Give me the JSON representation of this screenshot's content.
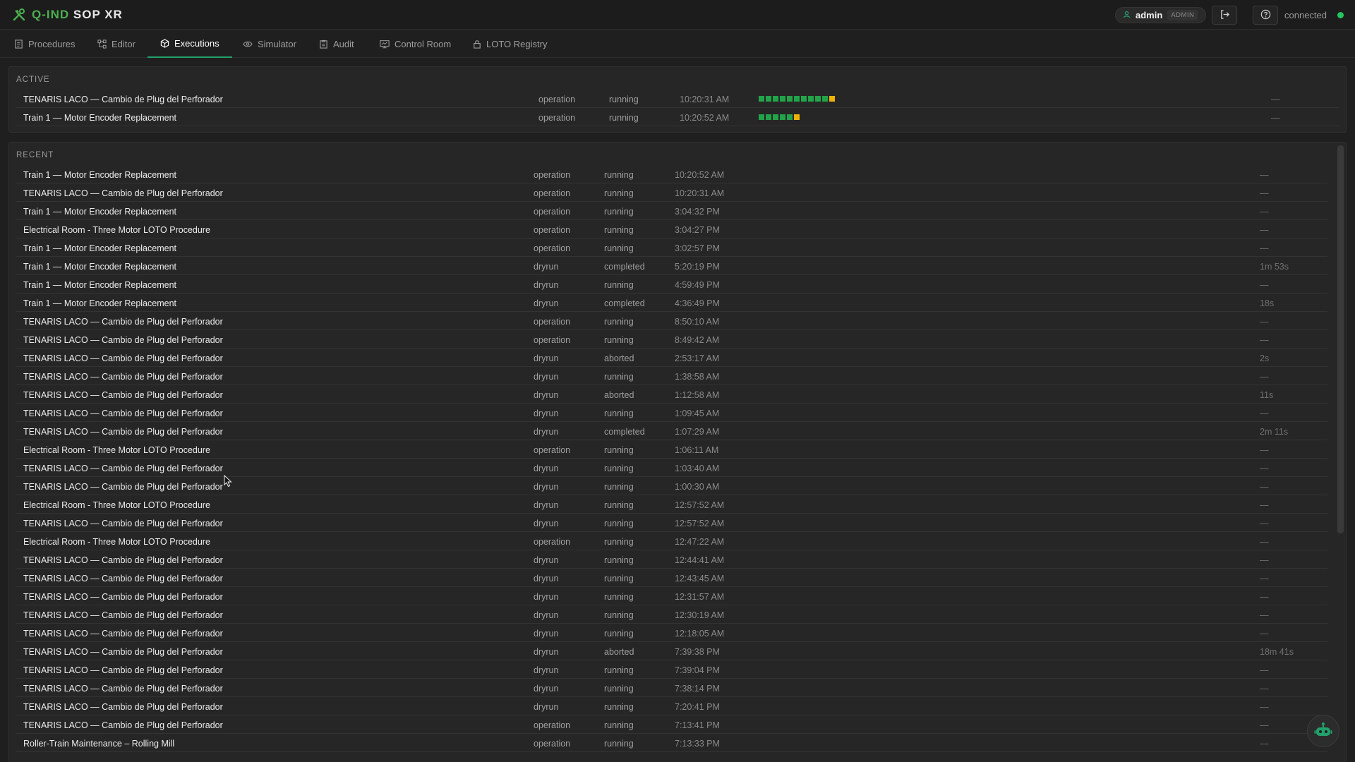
{
  "brand": {
    "part1": "Q-IND",
    "part2": "SOP XR"
  },
  "user": {
    "name": "admin",
    "role": "ADMIN"
  },
  "connection": {
    "label": "connected",
    "color": "#22c55e"
  },
  "icons": {
    "brand": "wrench-hammer-icon",
    "user": "user-icon",
    "logout": "logout-icon",
    "help": "help-icon",
    "assistant": "robot-icon"
  },
  "colors": {
    "accent": "#22a06b",
    "progress_done": "#22a34a",
    "progress_current": "#eab308"
  },
  "tabs": [
    {
      "label": "Procedures",
      "icon": "document-icon"
    },
    {
      "label": "Editor",
      "icon": "flow-icon"
    },
    {
      "label": "Executions",
      "icon": "cube-icon",
      "active": true
    },
    {
      "label": "Simulator",
      "icon": "eye-icon"
    },
    {
      "label": "Audit",
      "icon": "clipboard-icon"
    },
    {
      "label": "Control Room",
      "icon": "monitor-icon"
    },
    {
      "label": "LOTO Registry",
      "icon": "lock-icon"
    }
  ],
  "active": {
    "title": "ACTIVE",
    "rows": [
      {
        "name": "TENARIS LACO — Cambio de Plug del Perforador",
        "mode": "operation",
        "status": "running",
        "time": "10:20:31 AM",
        "progress": {
          "done": 10,
          "current": 1
        },
        "duration": "—"
      },
      {
        "name": "Train 1 — Motor Encoder Replacement",
        "mode": "operation",
        "status": "running",
        "time": "10:20:52 AM",
        "progress": {
          "done": 5,
          "current": 1
        },
        "duration": "—"
      }
    ]
  },
  "recent": {
    "title": "RECENT",
    "rows": [
      {
        "name": "Train 1 — Motor Encoder Replacement",
        "mode": "operation",
        "status": "running",
        "time": "10:20:52 AM",
        "duration": "—"
      },
      {
        "name": "TENARIS LACO — Cambio de Plug del Perforador",
        "mode": "operation",
        "status": "running",
        "time": "10:20:31 AM",
        "duration": "—"
      },
      {
        "name": "Train 1 — Motor Encoder Replacement",
        "mode": "operation",
        "status": "running",
        "time": "3:04:32 PM",
        "duration": "—"
      },
      {
        "name": "Electrical Room - Three Motor LOTO Procedure",
        "mode": "operation",
        "status": "running",
        "time": "3:04:27 PM",
        "duration": "—"
      },
      {
        "name": "Train 1 — Motor Encoder Replacement",
        "mode": "operation",
        "status": "running",
        "time": "3:02:57 PM",
        "duration": "—"
      },
      {
        "name": "Train 1 — Motor Encoder Replacement",
        "mode": "dryrun",
        "status": "completed",
        "time": "5:20:19 PM",
        "duration": "1m 53s"
      },
      {
        "name": "Train 1 — Motor Encoder Replacement",
        "mode": "dryrun",
        "status": "running",
        "time": "4:59:49 PM",
        "duration": "—"
      },
      {
        "name": "Train 1 — Motor Encoder Replacement",
        "mode": "dryrun",
        "status": "completed",
        "time": "4:36:49 PM",
        "duration": "18s"
      },
      {
        "name": "TENARIS LACO — Cambio de Plug del Perforador",
        "mode": "operation",
        "status": "running",
        "time": "8:50:10 AM",
        "duration": "—"
      },
      {
        "name": "TENARIS LACO — Cambio de Plug del Perforador",
        "mode": "operation",
        "status": "running",
        "time": "8:49:42 AM",
        "duration": "—"
      },
      {
        "name": "TENARIS LACO — Cambio de Plug del Perforador",
        "mode": "dryrun",
        "status": "aborted",
        "time": "2:53:17 AM",
        "duration": "2s"
      },
      {
        "name": "TENARIS LACO — Cambio de Plug del Perforador",
        "mode": "dryrun",
        "status": "running",
        "time": "1:38:58 AM",
        "duration": "—"
      },
      {
        "name": "TENARIS LACO — Cambio de Plug del Perforador",
        "mode": "dryrun",
        "status": "aborted",
        "time": "1:12:58 AM",
        "duration": "11s"
      },
      {
        "name": "TENARIS LACO — Cambio de Plug del Perforador",
        "mode": "dryrun",
        "status": "running",
        "time": "1:09:45 AM",
        "duration": "—"
      },
      {
        "name": "TENARIS LACO — Cambio de Plug del Perforador",
        "mode": "dryrun",
        "status": "completed",
        "time": "1:07:29 AM",
        "duration": "2m 11s"
      },
      {
        "name": "Electrical Room - Three Motor LOTO Procedure",
        "mode": "operation",
        "status": "running",
        "time": "1:06:11 AM",
        "duration": "—"
      },
      {
        "name": "TENARIS LACO — Cambio de Plug del Perforador",
        "mode": "dryrun",
        "status": "running",
        "time": "1:03:40 AM",
        "duration": "—"
      },
      {
        "name": "TENARIS LACO — Cambio de Plug del Perforador",
        "mode": "dryrun",
        "status": "running",
        "time": "1:00:30 AM",
        "duration": "—"
      },
      {
        "name": "Electrical Room - Three Motor LOTO Procedure",
        "mode": "dryrun",
        "status": "running",
        "time": "12:57:52 AM",
        "duration": "—"
      },
      {
        "name": "TENARIS LACO — Cambio de Plug del Perforador",
        "mode": "dryrun",
        "status": "running",
        "time": "12:57:52 AM",
        "duration": "—"
      },
      {
        "name": "Electrical Room - Three Motor LOTO Procedure",
        "mode": "operation",
        "status": "running",
        "time": "12:47:22 AM",
        "duration": "—"
      },
      {
        "name": "TENARIS LACO — Cambio de Plug del Perforador",
        "mode": "dryrun",
        "status": "running",
        "time": "12:44:41 AM",
        "duration": "—"
      },
      {
        "name": "TENARIS LACO — Cambio de Plug del Perforador",
        "mode": "dryrun",
        "status": "running",
        "time": "12:43:45 AM",
        "duration": "—"
      },
      {
        "name": "TENARIS LACO — Cambio de Plug del Perforador",
        "mode": "dryrun",
        "status": "running",
        "time": "12:31:57 AM",
        "duration": "—"
      },
      {
        "name": "TENARIS LACO — Cambio de Plug del Perforador",
        "mode": "dryrun",
        "status": "running",
        "time": "12:30:19 AM",
        "duration": "—"
      },
      {
        "name": "TENARIS LACO — Cambio de Plug del Perforador",
        "mode": "dryrun",
        "status": "running",
        "time": "12:18:05 AM",
        "duration": "—"
      },
      {
        "name": "TENARIS LACO — Cambio de Plug del Perforador",
        "mode": "dryrun",
        "status": "aborted",
        "time": "7:39:38 PM",
        "duration": "18m 41s"
      },
      {
        "name": "TENARIS LACO — Cambio de Plug del Perforador",
        "mode": "dryrun",
        "status": "running",
        "time": "7:39:04 PM",
        "duration": "—"
      },
      {
        "name": "TENARIS LACO — Cambio de Plug del Perforador",
        "mode": "dryrun",
        "status": "running",
        "time": "7:38:14 PM",
        "duration": "—"
      },
      {
        "name": "TENARIS LACO — Cambio de Plug del Perforador",
        "mode": "dryrun",
        "status": "running",
        "time": "7:20:41 PM",
        "duration": "—"
      },
      {
        "name": "TENARIS LACO — Cambio de Plug del Perforador",
        "mode": "operation",
        "status": "running",
        "time": "7:13:41 PM",
        "duration": "—"
      },
      {
        "name": "Roller-Train Maintenance – Rolling Mill",
        "mode": "operation",
        "status": "running",
        "time": "7:13:33 PM",
        "duration": "—"
      }
    ]
  }
}
